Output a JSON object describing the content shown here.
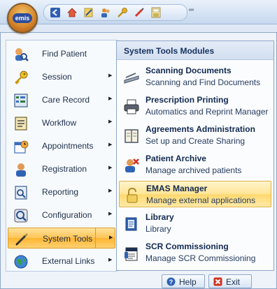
{
  "app": {
    "logo_text": "emis"
  },
  "quick_access": {
    "icons": [
      "back-icon",
      "home-icon",
      "edit-icon",
      "people-icon",
      "key-icon",
      "pen-icon",
      "save-icon"
    ],
    "dropdown_glyph": "═"
  },
  "main_menu": {
    "items": [
      {
        "label": "Find Patient",
        "icon": "find-patient-icon",
        "has_submenu": false
      },
      {
        "label": "Session",
        "icon": "key-icon",
        "has_submenu": true
      },
      {
        "label": "Care Record",
        "icon": "care-record-icon",
        "has_submenu": true
      },
      {
        "label": "Workflow",
        "icon": "workflow-icon",
        "has_submenu": true
      },
      {
        "label": "Appointments",
        "icon": "appointments-icon",
        "has_submenu": true
      },
      {
        "label": "Registration",
        "icon": "registration-icon",
        "has_submenu": true
      },
      {
        "label": "Reporting",
        "icon": "reporting-icon",
        "has_submenu": true
      },
      {
        "label": "Configuration",
        "icon": "configuration-icon",
        "has_submenu": true
      },
      {
        "label": "System Tools",
        "icon": "system-tools-icon",
        "has_submenu": true,
        "selected": true
      },
      {
        "label": "External Links",
        "icon": "external-links-icon",
        "has_submenu": true
      }
    ],
    "arrow": "▶"
  },
  "submenu": {
    "header": "System Tools Modules",
    "items": [
      {
        "title": "Scanning Documents",
        "desc": "Scanning and Find Documents",
        "icon": "scanner-icon"
      },
      {
        "title": "Prescription Printing",
        "desc": "Automatics and Reprint Manager",
        "icon": "printer-icon"
      },
      {
        "title": "Agreements Administration",
        "desc": "Set up and Create Sharing",
        "icon": "book-icon"
      },
      {
        "title": "Patient Archive",
        "desc": "Manage archived patients",
        "icon": "patient-archive-icon"
      },
      {
        "title": "EMAS Manager",
        "desc": "Manage external applications",
        "icon": "padlock-icon",
        "selected": true
      },
      {
        "title": "Library",
        "desc": "Library",
        "icon": "library-icon"
      },
      {
        "title": "SCR Commissioning",
        "desc": "Manage SCR Commissioning",
        "icon": "scr-icon"
      }
    ]
  },
  "footer": {
    "help_label": "Help",
    "exit_label": "Exit"
  },
  "colors": {
    "selected_item": "#ffc456",
    "menu_border": "#8ea7c9",
    "accent_blue": "#2c4d9c"
  }
}
